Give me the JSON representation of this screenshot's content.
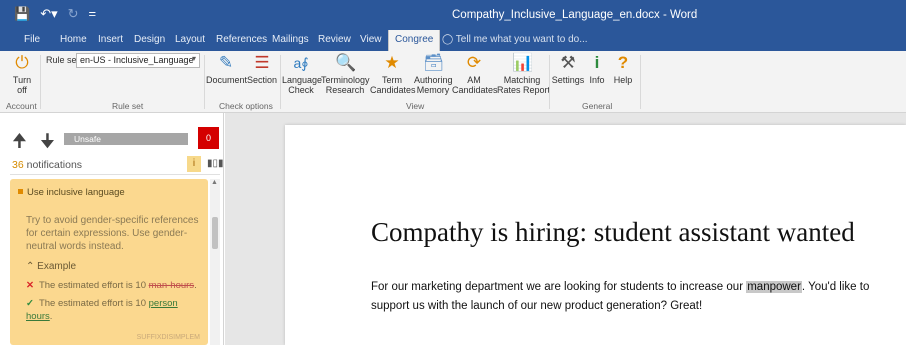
{
  "window": {
    "title": "Compathy_Inclusive_Language_en.docx - Word"
  },
  "tabs": [
    "File",
    "Home",
    "Insert",
    "Design",
    "Layout",
    "References",
    "Mailings",
    "Review",
    "View",
    "Congree"
  ],
  "tell_me": "Tell me what you want to do...",
  "ribbon": {
    "account": {
      "turn_off": [
        "Turn",
        "off"
      ],
      "label": "Account"
    },
    "rule_set": {
      "label": "Rule set",
      "selected": "en-US - Inclusive_Language",
      "group_label": "Rule set"
    },
    "check_options": {
      "document": "Document",
      "section": "Section",
      "group_label": "Check options"
    },
    "view": {
      "buttons": [
        [
          "Language",
          "Check"
        ],
        [
          "Terminology",
          "Research"
        ],
        [
          "Term",
          "Candidates"
        ],
        [
          "Authoring",
          "Memory"
        ],
        [
          "AM",
          "Candidates"
        ],
        [
          "Matching",
          "Rates Report"
        ]
      ],
      "group_label": "View"
    },
    "general": {
      "settings": "Settings",
      "info": "Info",
      "help": "Help",
      "group_label": "General"
    }
  },
  "sidepane": {
    "status": "Unsafe",
    "badge": "0",
    "notifications_count": "36",
    "notifications_label": " notifications",
    "card": {
      "title": "Use inclusive language",
      "body": "Try to avoid gender-specific references for certain expressions. Use gender-neutral words instead.",
      "example_label": "Example",
      "bad_prefix": "The estimated effort is 10 ",
      "bad_term": "man-hours",
      "bad_suffix": ".",
      "good_prefix": "The estimated effort is 10 ",
      "good_term": "person hours",
      "good_suffix": ".",
      "footer": "SUFFIXDISIMPLEM"
    }
  },
  "document": {
    "heading": "Compathy is hiring: student assistant wanted",
    "para_before": "For our marketing department we are looking for students to increase our ",
    "para_highlight": "manpower",
    "para_after": ". You'd like to support us with the launch of our new product generation? Great!"
  },
  "colors": {
    "word_blue": "#2b579a",
    "card_yellow": "#fbd88f",
    "badge_red": "#d40000"
  }
}
